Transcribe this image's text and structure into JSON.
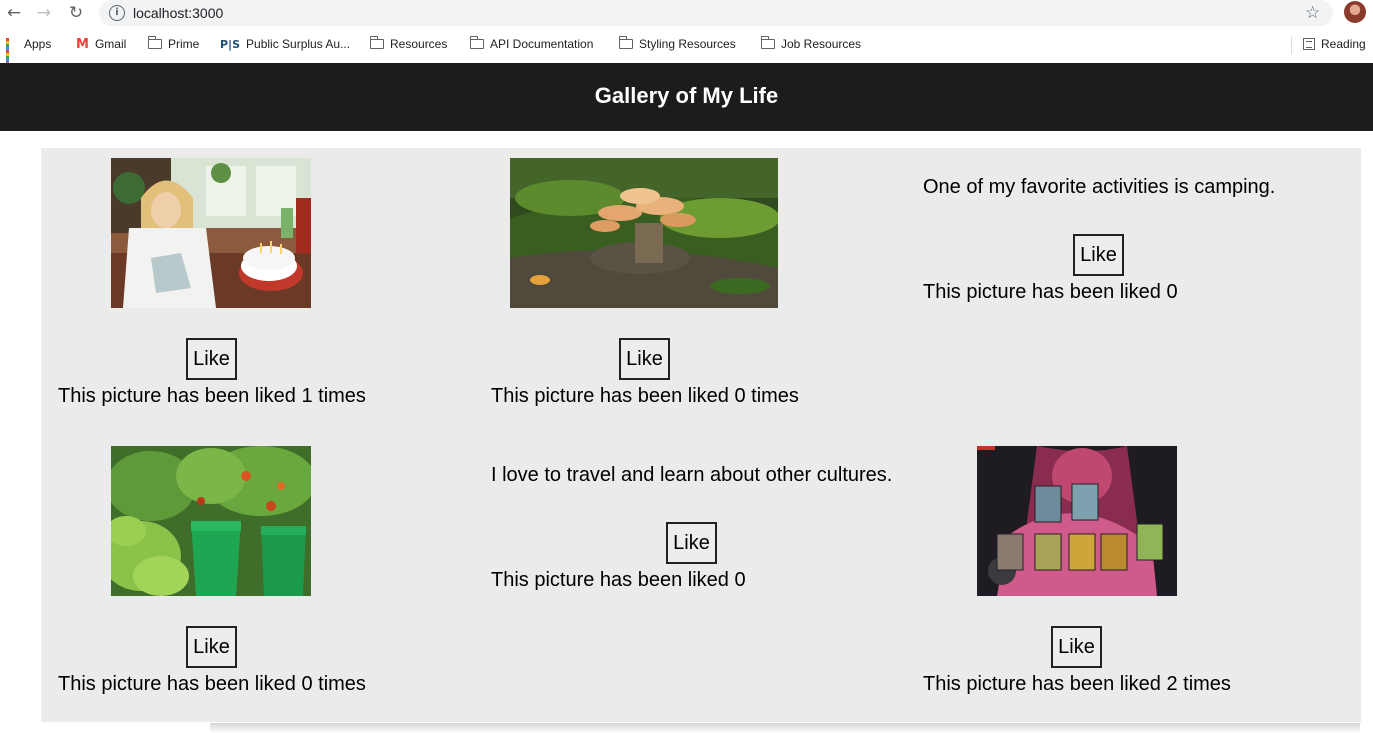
{
  "browser": {
    "url": "localhost:3000",
    "bookmarks": [
      {
        "label": "Apps",
        "icon": "apps-grid-icon"
      },
      {
        "label": "Gmail",
        "icon": "gmail-icon"
      },
      {
        "label": "Prime",
        "icon": "folder-icon"
      },
      {
        "label": "Public Surplus Au...",
        "icon": "public-surplus-icon"
      },
      {
        "label": "Resources",
        "icon": "folder-icon"
      },
      {
        "label": "API Documentation",
        "icon": "folder-icon"
      },
      {
        "label": "Styling Resources",
        "icon": "folder-icon"
      },
      {
        "label": "Job Resources",
        "icon": "folder-icon"
      },
      {
        "label": "Reading",
        "icon": "reading-list-icon"
      }
    ]
  },
  "header": {
    "title": "Gallery of My Life"
  },
  "gallery": {
    "items": [
      {
        "type": "image",
        "icon": "birthday-cake-photo",
        "like_label": "Like",
        "count_text": "This picture has been liked 1 times"
      },
      {
        "type": "image",
        "icon": "mushroom-log-photo",
        "like_label": "Like",
        "count_text": "This picture has been liked 0 times"
      },
      {
        "type": "text",
        "description": "One of my favorite activities is camping.",
        "like_label": "Like",
        "count_text": "This picture has been liked 0"
      },
      {
        "type": "image",
        "icon": "pepper-plants-photo",
        "like_label": "Like",
        "count_text": "This picture has been liked 0 times"
      },
      {
        "type": "text",
        "description": "I love to travel and learn about other cultures.",
        "like_label": "Like",
        "count_text": "This picture has been liked 0"
      },
      {
        "type": "image",
        "icon": "trading-cards-photo",
        "like_label": "Like",
        "count_text": "This picture has been liked 2 times"
      }
    ]
  },
  "colors": {
    "header_bg": "#1c1c1c",
    "gallery_bg": "#ebebeb",
    "button_border": "#222222"
  }
}
